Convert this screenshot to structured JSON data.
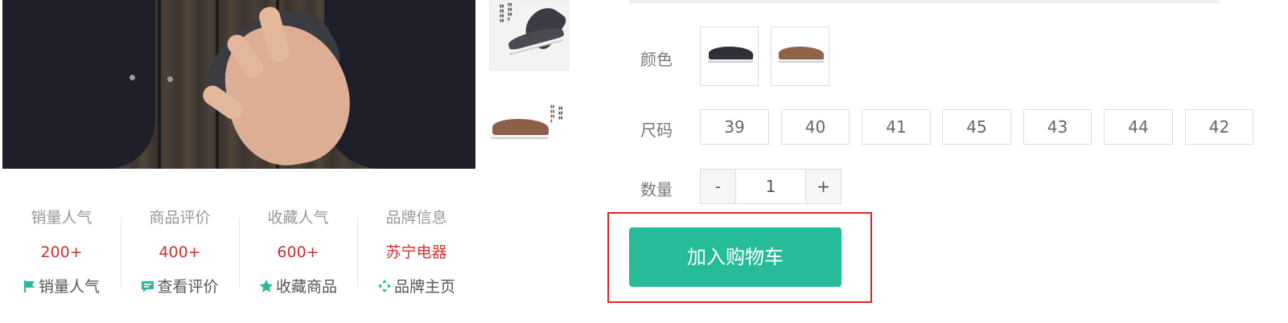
{
  "stats": [
    {
      "label": "销量人气",
      "value": "200+",
      "link": "销量人气",
      "icon": "flag-icon"
    },
    {
      "label": "商品评价",
      "value": "400+",
      "link": "查看评价",
      "icon": "comment-icon"
    },
    {
      "label": "收藏人气",
      "value": "600+",
      "link": "收藏商品",
      "icon": "star-icon"
    },
    {
      "label": "品牌信息",
      "value": "苏宁电器",
      "link": "品牌主页",
      "icon": "brand-icon"
    }
  ],
  "options": {
    "color_label": "颜色",
    "size_label": "尺码",
    "quantity_label": "数量",
    "sizes": [
      "39",
      "40",
      "41",
      "45",
      "43",
      "44",
      "42"
    ],
    "quantity": {
      "minus": "-",
      "value": "1",
      "plus": "+"
    }
  },
  "cart_button": "加入购物车",
  "colors": {
    "accent": "#26bc99",
    "price": "#d0302f",
    "highlight": "#e32228"
  }
}
